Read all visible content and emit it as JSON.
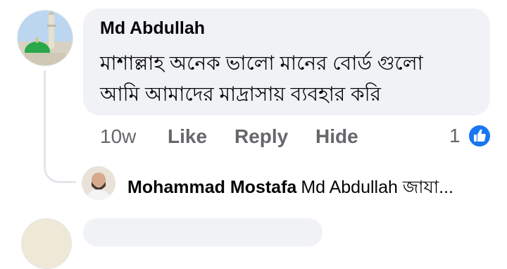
{
  "comment": {
    "author": "Md Abdullah",
    "lines": [
      "মাশাল্লাহ অনেক ভালো মানের বোর্ড গুলো",
      "আমি আমাদের মাদ্রাসায় ব্যবহার করি"
    ],
    "time": "10w",
    "actions": {
      "like": "Like",
      "reply": "Reply",
      "hide": "Hide"
    },
    "reaction_count": "1",
    "reaction_icon": "like-thumb-icon"
  },
  "reply": {
    "author": "Mohammad Mostafa",
    "preview": "Md Abdullah জাযা..."
  },
  "colors": {
    "bubble_bg": "#f0f2f5",
    "secondary_text": "#65676b",
    "like_blue": "#1877f2",
    "thread_line": "#e4e6eb"
  }
}
